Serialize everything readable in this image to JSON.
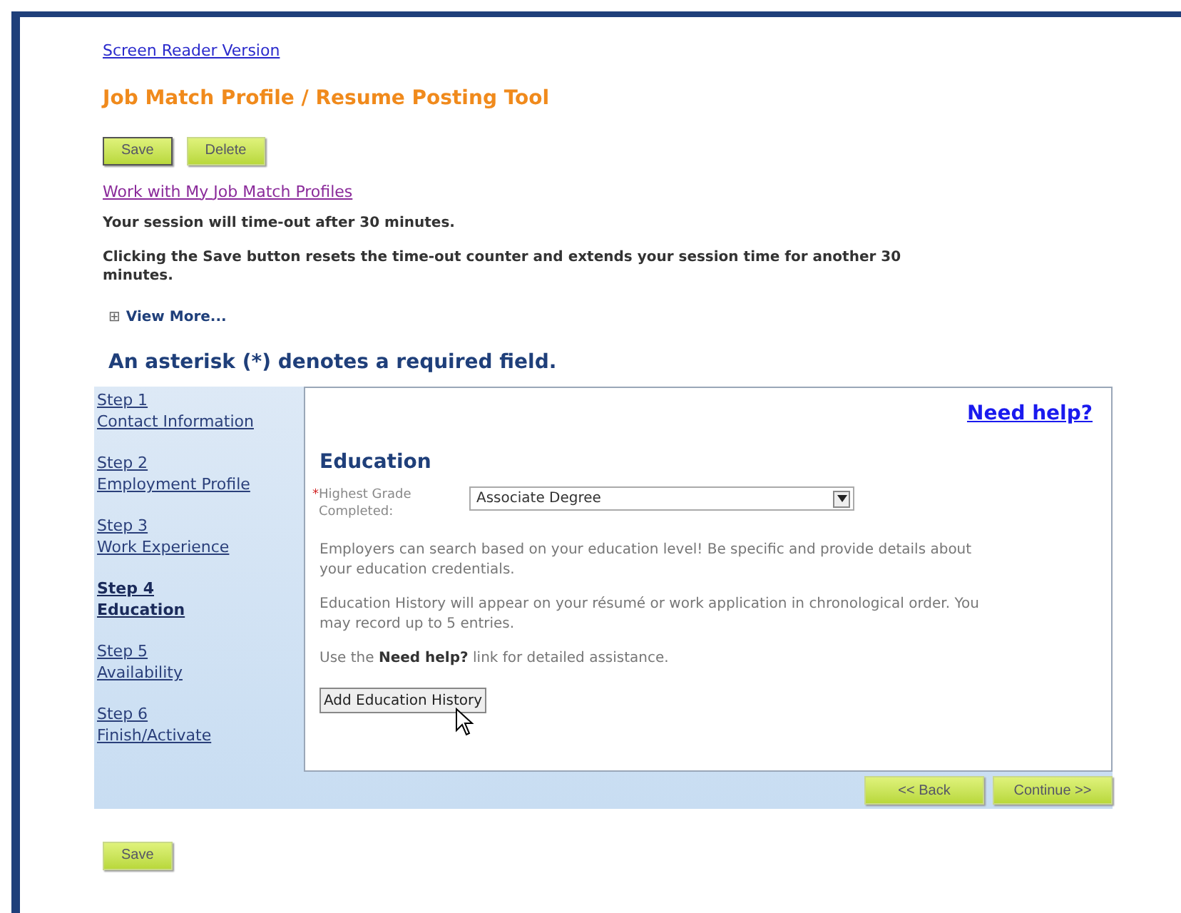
{
  "screen_reader_link": "Screen Reader Version",
  "title": "Job Match Profile / Resume Posting Tool",
  "top_buttons": [
    {
      "label": "Save",
      "focused": true
    },
    {
      "label": "Delete",
      "focused": false
    }
  ],
  "profiles_link": "Work with My Job Match Profiles",
  "session_notice": "Your session will time-out after 30 minutes.",
  "save_notice": "Clicking the Save button resets the time-out counter and extends your session time for another 30 minutes.",
  "view_more": {
    "icon": "⊞",
    "label": "View More..."
  },
  "required_notice": "An asterisk (*) denotes a required field.",
  "steps": [
    {
      "step": "Step 1",
      "label": "Contact Information",
      "selected": false
    },
    {
      "step": "Step 2",
      "label": "Employment Profile",
      "selected": false
    },
    {
      "step": "Step 3",
      "label": "Work Experience",
      "selected": false
    },
    {
      "step": "Step 4",
      "label": "Education",
      "selected": true
    },
    {
      "step": "Step 5",
      "label": "Availability",
      "selected": false
    },
    {
      "step": "Step 6",
      "label": "Finish/Activate",
      "selected": false
    }
  ],
  "help_link": "Need help?",
  "section_title": "Education",
  "field": {
    "required_marker": "*",
    "label": "Highest Grade Completed:",
    "value": "Associate Degree"
  },
  "paragraphs": [
    "Employers can search based on your education level! Be specific and provide details about your education credentials.",
    "Education History will appear on your résumé or work application in chronological order. You may record up to 5 entries.",
    "Use the **Need help?** link for detailed assistance."
  ],
  "add_button": "Add Education History",
  "nav_buttons": [
    "<< Back",
    "Continue >>"
  ],
  "bottom_button": "Save"
}
